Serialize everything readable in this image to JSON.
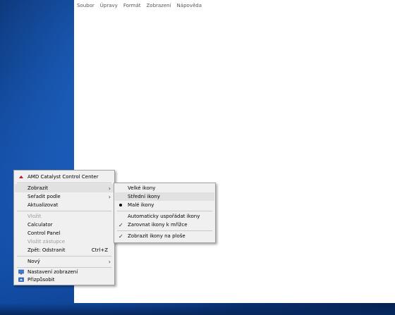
{
  "notepad": {
    "menu": [
      "Soubor",
      "Úpravy",
      "Formát",
      "Zobrazení",
      "Nápověda"
    ]
  },
  "context_menu": {
    "amd": "AMD Catalyst Control Center",
    "view": "Zobrazit",
    "sort": "Seřadit podle",
    "refresh": "Aktualizovat",
    "paste": "Vložit",
    "calculator": "Calculator",
    "control_panel": "Control Panel",
    "paste_shortcut": "Vložit zástupce",
    "undo_delete": "Zpět: Odstranit",
    "undo_shortcut": "Ctrl+Z",
    "new": "Nový",
    "display_settings": "Nastavení zobrazení",
    "personalize": "Přizpůsobit"
  },
  "view_submenu": {
    "large_icons": "Velké ikony",
    "medium_icons": "Střední ikony",
    "small_icons": "Malé ikony",
    "auto_arrange": "Automaticky uspořádat ikony",
    "align_grid": "Zarovnat ikony k mřížce",
    "show_desktop_icons": "Zobrazit ikony na ploše"
  },
  "colors": {
    "menu_bg": "#f0f0f0",
    "highlight": "#e1e1e1",
    "desktop": "#0b3d86"
  }
}
